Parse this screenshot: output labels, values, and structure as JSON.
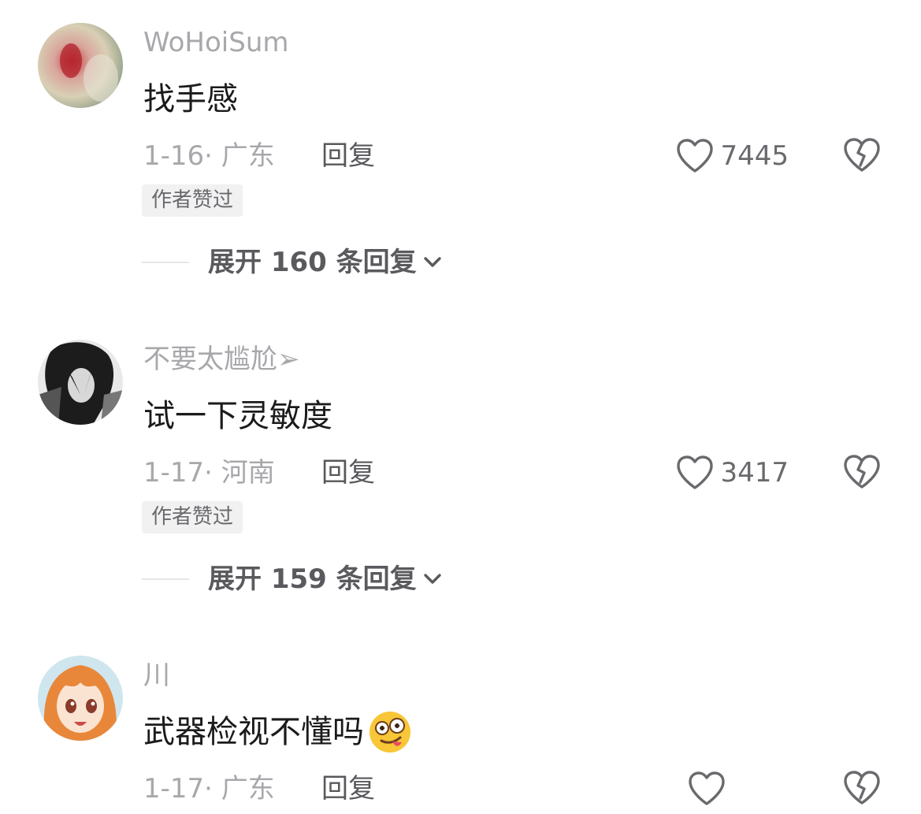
{
  "comments": [
    {
      "username": "WoHoiSum",
      "content": "找手感",
      "date": "1-16",
      "separator": "·",
      "location": "广东",
      "reply_label": "回复",
      "likes": "7445",
      "badge": "作者赞过",
      "expand_label": "展开 160 条回复"
    },
    {
      "username": "不要太尴尬➢",
      "content": "试一下灵敏度",
      "date": "1-17",
      "separator": "·",
      "location": "河南",
      "reply_label": "回复",
      "likes": "3417",
      "badge": "作者赞过",
      "expand_label": "展开 159 条回复"
    },
    {
      "username": "川",
      "content": "武器检视不懂吗",
      "emoji": "drooling-face-emoji",
      "date": "1-17",
      "separator": "·",
      "location": "广东",
      "reply_label": "回复"
    }
  ],
  "icons": {
    "like": "heart-outline-icon",
    "dislike": "broken-heart-icon",
    "expand": "chevron-down-icon"
  },
  "colors": {
    "text_primary": "#1b1b1d",
    "text_secondary": "#a8a8ac",
    "badge_bg": "#f1f1f2"
  }
}
